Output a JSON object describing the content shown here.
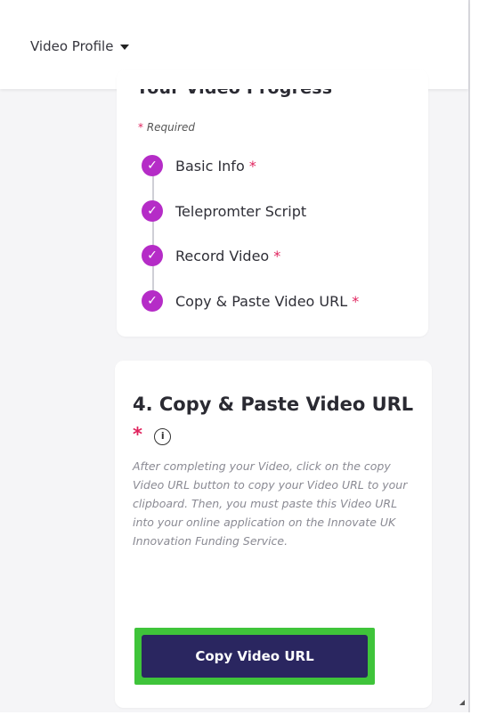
{
  "header": {
    "profile_menu_label": "Video Profile"
  },
  "progress": {
    "title": "Your Video Progress",
    "required_label": "Required",
    "required_marker": "*",
    "steps": [
      {
        "label": "Basic Info",
        "required": "*"
      },
      {
        "label": "Telepromter Script",
        "required": ""
      },
      {
        "label": "Record Video",
        "required": "*"
      },
      {
        "label": "Copy & Paste Video URL",
        "required": "*"
      }
    ]
  },
  "current_step": {
    "heading": "4. Copy & Paste Video URL",
    "required_marker": "*",
    "info_icon_glyph": "i",
    "description": "After completing your Video, click on the copy Video URL button to copy your Video URL to your clipboard. Then, you must paste this Video URL into your online application on the Innovate UK Innovation Funding Service.",
    "button_label": "Copy Video URL"
  },
  "colors": {
    "check_accent": "#b52cc7",
    "button_bg": "#2a2660",
    "button_outline": "#3fc43a",
    "required_star": "#e0245e"
  }
}
